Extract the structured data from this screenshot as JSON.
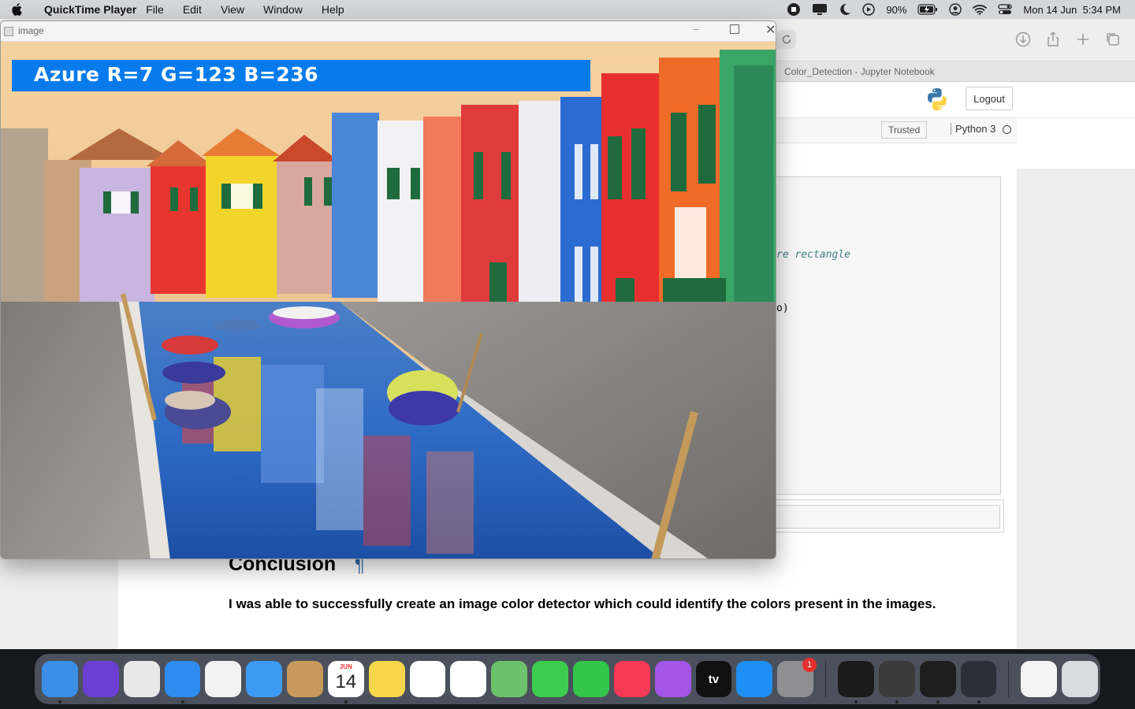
{
  "menubar": {
    "app_name": "QuickTime Player",
    "menus": [
      "File",
      "Edit",
      "View",
      "Window",
      "Help"
    ],
    "battery": "90%",
    "datetime": "Mon 14 Jun  5:34 PM"
  },
  "browser": {
    "tab_title": "Color_Detection - Jupyter Notebook"
  },
  "notebook": {
    "logout_label": "Logout",
    "trusted_label": "Trusted",
    "kernel_name": "Python 3",
    "code_comment_fragment": "re rectangle",
    "code_line_fragment": "o)",
    "heading": "Conclusion",
    "pilcrow": "¶",
    "conclusion_text": "I was able to successfully create an image color detector which could identify the colors present in the images."
  },
  "image_window": {
    "title": "image",
    "color_label": "Azure R=7 G=123 B=236",
    "label_color": "#077bec"
  },
  "dock": {
    "apps": [
      {
        "name": "Finder",
        "color": "#3a8ee6"
      },
      {
        "name": "Siri",
        "color": "#6a3fd1"
      },
      {
        "name": "Launchpad",
        "color": "#e8e8e8"
      },
      {
        "name": "Safari",
        "color": "#2f8cf0"
      },
      {
        "name": "Chrome",
        "color": "#f2f2f2"
      },
      {
        "name": "Mail",
        "color": "#3c9af2"
      },
      {
        "name": "Contacts",
        "color": "#c79a5b"
      },
      {
        "name": "Calendar",
        "color": "#ffffff"
      },
      {
        "name": "Notes",
        "color": "#f6d64a"
      },
      {
        "name": "Reminders",
        "color": "#ffffff"
      },
      {
        "name": "Photos",
        "color": "#ffffff"
      },
      {
        "name": "Maps",
        "color": "#6cc26a"
      },
      {
        "name": "Messages",
        "color": "#3dcd4e"
      },
      {
        "name": "FaceTime",
        "color": "#33c64a"
      },
      {
        "name": "Music",
        "color": "#f73a55"
      },
      {
        "name": "Podcasts",
        "color": "#a355e8"
      },
      {
        "name": "TV",
        "color": "#111111"
      },
      {
        "name": "App Store",
        "color": "#1e8ff5"
      },
      {
        "name": "System Preferences",
        "color": "#8e8e93"
      },
      {
        "name": "Terminal",
        "color": "#1b1b1b"
      },
      {
        "name": "Sublime Text",
        "color": "#3b3b3b"
      },
      {
        "name": "Activity",
        "color": "#1e1e1e"
      },
      {
        "name": "QuickTime Player",
        "color": "#2a2f38"
      },
      {
        "name": "Documents",
        "color": "#f4f4f4"
      },
      {
        "name": "Trash",
        "color": "#d8dbe0"
      }
    ],
    "calendar": {
      "month": "JUN",
      "day": "14"
    },
    "sysprefs_badge": "1",
    "tv_label": "tv"
  }
}
